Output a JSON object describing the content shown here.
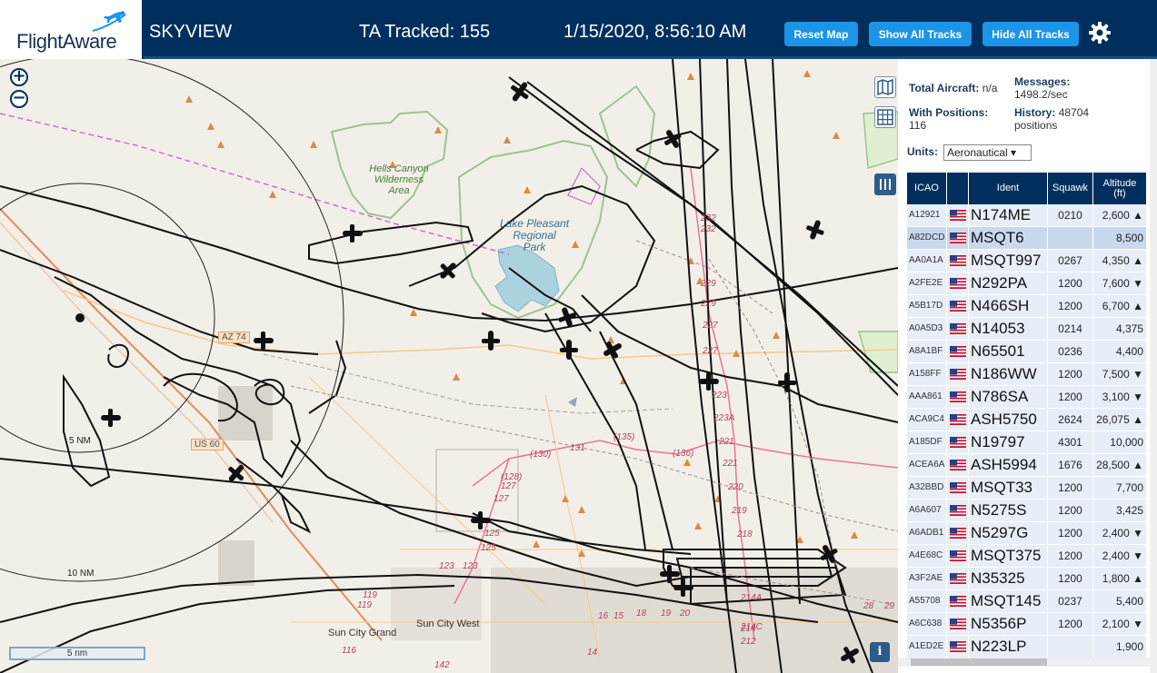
{
  "header": {
    "logo_text": "FlightAware",
    "app_name": "SKYVIEW",
    "tracked": "TA Tracked: 155",
    "datetime": "1/15/2020, 8:56:10 AM",
    "buttons": {
      "reset": "Reset Map",
      "show_all": "Show All Tracks",
      "hide_all": "Hide All Tracks"
    },
    "accent": "#1e94e6",
    "bar_color": "#002f5d"
  },
  "map": {
    "labels": {
      "hells_canyon": "Hells Canyon",
      "wilderness": "Wilderness",
      "area": "Area",
      "lake": "Lake Pleasant",
      "regional": "Regional",
      "park": "Park",
      "az74": "AZ 74",
      "us60": "US 60",
      "range5": "5 NM",
      "range10": "10 NM",
      "sun_city_grand": "Sun City Grand",
      "sun_city_west": "Sun City West"
    },
    "route_numbers": [
      "232",
      "232",
      "229",
      "229",
      "227",
      "227",
      "223",
      "223A",
      "221",
      "221",
      "220",
      "219",
      "218",
      "(136)",
      "(135)",
      "131",
      "(130)",
      "(128)",
      "127",
      "127",
      "125",
      "125",
      "123",
      "123",
      "119",
      "119",
      "116",
      "142",
      "14",
      "214",
      "214A",
      "214C",
      "212",
      "28",
      "29",
      "18",
      "19",
      "20",
      "16",
      "15"
    ],
    "scale_label": "5 nm",
    "zoom_in": "+",
    "zoom_out": "−",
    "info": "i"
  },
  "panel": {
    "total_label": "Total Aircraft:",
    "total_value": "n/a",
    "messages_label": "Messages:",
    "messages_value": "1498.2/sec",
    "positions_label": "With Positions:",
    "positions_value": "116",
    "history_label": "History:",
    "history_value": "48704",
    "history_unit": "positions",
    "units_label": "Units:",
    "units_value": "Aeronautical ▾"
  },
  "table": {
    "headers": {
      "icao": "ICAO",
      "ident": "Ident",
      "squawk": "Squawk",
      "alt1": "Altitude",
      "alt2": "(ft)"
    },
    "rows": [
      {
        "icao": "A12921",
        "ident": "N174ME",
        "squawk": "0210",
        "alt": "2,600 ▲"
      },
      {
        "icao": "A82DCD",
        "ident": "MSQT6",
        "squawk": "",
        "alt": "8,500"
      },
      {
        "icao": "AA0A1A",
        "ident": "MSQT997",
        "squawk": "0267",
        "alt": "4,350 ▲"
      },
      {
        "icao": "A2FE2E",
        "ident": "N292PA",
        "squawk": "1200",
        "alt": "7,600 ▼"
      },
      {
        "icao": "A5B17D",
        "ident": "N466SH",
        "squawk": "1200",
        "alt": "6,700 ▲"
      },
      {
        "icao": "A0A5D3",
        "ident": "N14053",
        "squawk": "0214",
        "alt": "4,375"
      },
      {
        "icao": "A8A1BF",
        "ident": "N65501",
        "squawk": "0236",
        "alt": "4,400"
      },
      {
        "icao": "A158FF",
        "ident": "N186WW",
        "squawk": "1200",
        "alt": "7,500 ▼"
      },
      {
        "icao": "AAA861",
        "ident": "N786SA",
        "squawk": "1200",
        "alt": "3,100 ▼"
      },
      {
        "icao": "ACA9C4",
        "ident": "ASH5750",
        "squawk": "2624",
        "alt": "26,075 ▲"
      },
      {
        "icao": "A185DF",
        "ident": "N19797",
        "squawk": "4301",
        "alt": "10,000"
      },
      {
        "icao": "ACEA6A",
        "ident": "ASH5994",
        "squawk": "1676",
        "alt": "28,500 ▲"
      },
      {
        "icao": "A32BBD",
        "ident": "MSQT33",
        "squawk": "1200",
        "alt": "7,700"
      },
      {
        "icao": "A6A607",
        "ident": "N5275S",
        "squawk": "1200",
        "alt": "3,425"
      },
      {
        "icao": "A6ADB1",
        "ident": "N5297G",
        "squawk": "1200",
        "alt": "2,400 ▼"
      },
      {
        "icao": "A4E68C",
        "ident": "MSQT375",
        "squawk": "1200",
        "alt": "2,400 ▼"
      },
      {
        "icao": "A3F2AE",
        "ident": "N35325",
        "squawk": "1200",
        "alt": "1,800 ▲"
      },
      {
        "icao": "A55708",
        "ident": "MSQT145",
        "squawk": "0237",
        "alt": "5,400"
      },
      {
        "icao": "A6C638",
        "ident": "N5356P",
        "squawk": "1200",
        "alt": "2,100 ▼"
      },
      {
        "icao": "A1ED2E",
        "ident": "N223LP",
        "squawk": "",
        "alt": "1,900"
      }
    ],
    "selected_index": 1
  }
}
